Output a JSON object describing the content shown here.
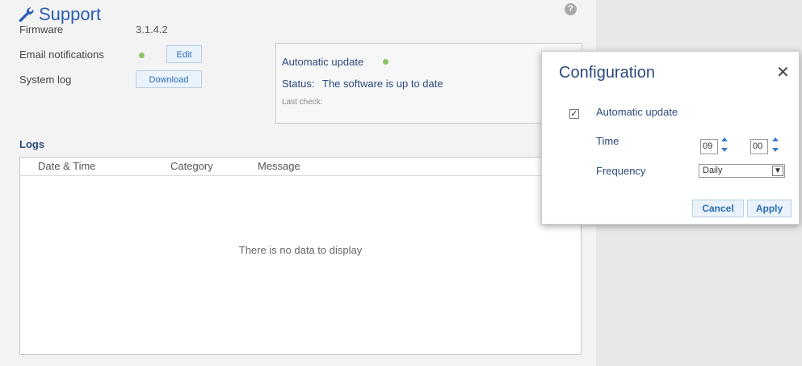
{
  "header": {
    "title": "Support",
    "help_icon": "?"
  },
  "info": {
    "firmware_label": "Firmware",
    "firmware_value": "3.1.4.2",
    "email_label": "Email notifications",
    "email_edit": "Edit",
    "syslog_label": "System log",
    "syslog_download": "Download"
  },
  "auto_update_box": {
    "title": "Automatic update",
    "status_label": "Status:",
    "status_value": "The software is up to date",
    "last_check_label": "Last check:"
  },
  "logs": {
    "title": "Logs",
    "columns": [
      "Date & Time",
      "Category",
      "Message"
    ],
    "empty_text": "There is no data to display"
  },
  "modal": {
    "title": "Configuration",
    "close": "✕",
    "auto_update_label": "Automatic update",
    "auto_update_checked": true,
    "time_label": "Time",
    "hour": "09",
    "minute": "00",
    "frequency_label": "Frequency",
    "frequency_value": "Daily",
    "cancel": "Cancel",
    "apply": "Apply"
  },
  "colors": {
    "accent": "#2a5db0",
    "status_ok": "#8fc463"
  }
}
